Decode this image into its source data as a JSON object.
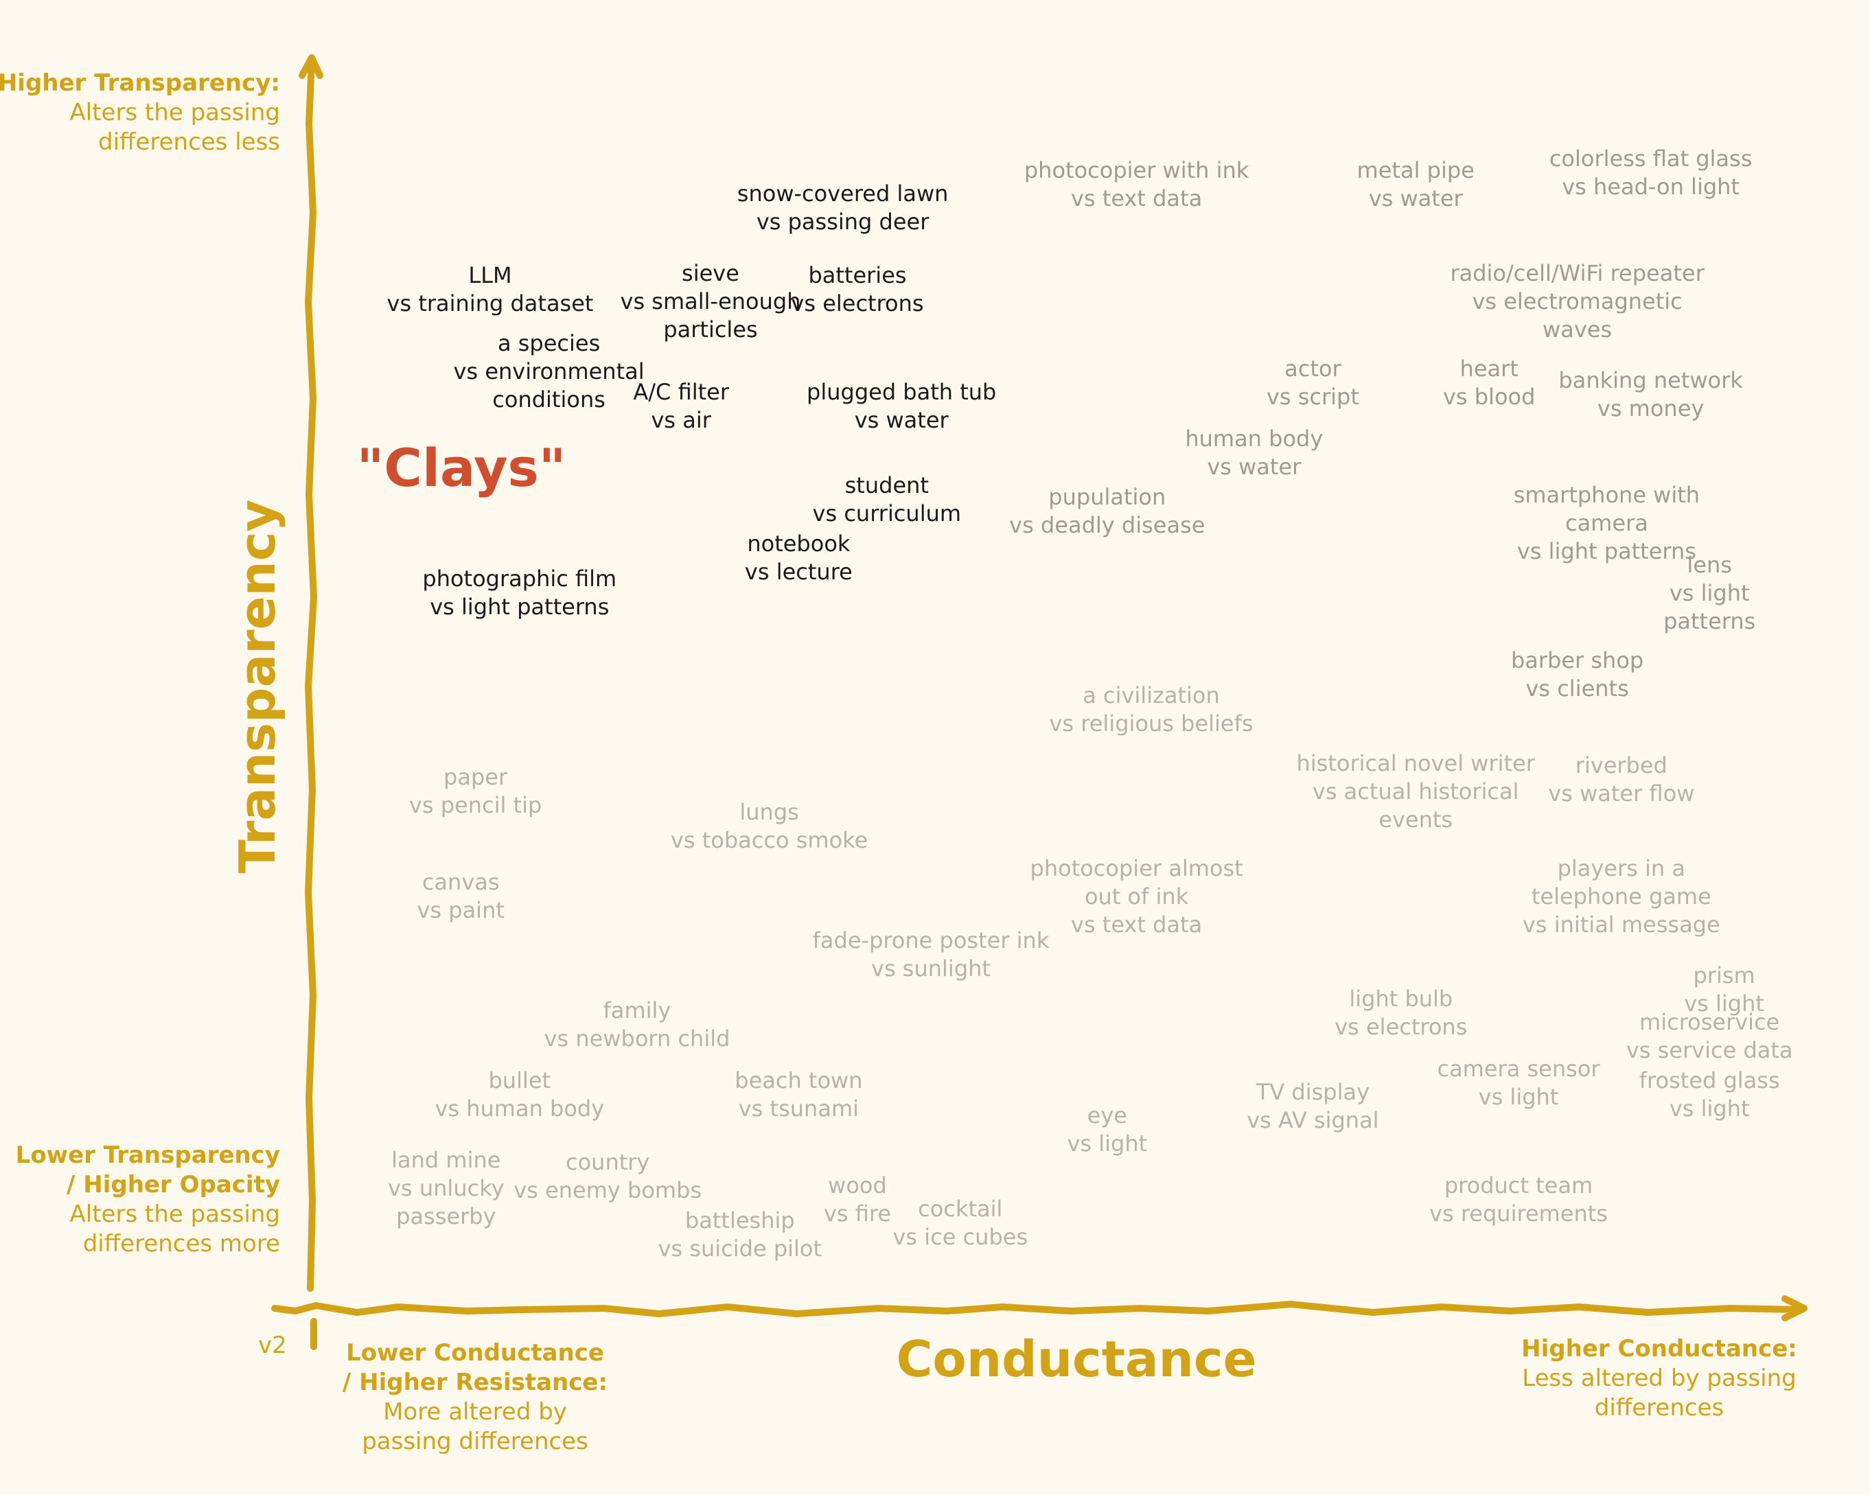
{
  "chart_data": {
    "type": "scatter",
    "title": "",
    "xlabel": "Conductance",
    "ylabel": "Transparency",
    "version_label": "v2",
    "highlight_label": "\"Clays\"",
    "axis_notes": {
      "y_high": {
        "heading": "Higher Transparency:",
        "lines": [
          "Alters the passing",
          "differences less"
        ]
      },
      "y_low": {
        "heading_lines": [
          "Lower Transparency",
          "/ Higher Opacity"
        ],
        "lines": [
          "Alters the passing",
          "differences more"
        ]
      },
      "x_low": {
        "heading_lines": [
          "Lower Conductance",
          "/ Higher Resistance:"
        ],
        "lines": [
          "More altered by",
          "passing differences"
        ]
      },
      "x_high": {
        "heading": "Higher Conductance:",
        "lines": [
          "Less altered by passing",
          "differences"
        ]
      }
    },
    "xlim": [
      0,
      100
    ],
    "ylim": [
      0,
      100
    ],
    "points": [
      {
        "lines": [
          "snow-covered lawn",
          "vs passing deer"
        ],
        "x": 34,
        "y": 91,
        "group": "clay"
      },
      {
        "lines": [
          "LLM",
          "vs training dataset"
        ],
        "x": 10,
        "y": 84,
        "group": "clay"
      },
      {
        "lines": [
          "sieve",
          "vs small-enough",
          "particles"
        ],
        "x": 25,
        "y": 83,
        "group": "clay"
      },
      {
        "lines": [
          "batteries",
          "vs electrons"
        ],
        "x": 35,
        "y": 84,
        "group": "clay"
      },
      {
        "lines": [
          "a species",
          "vs environmental",
          "conditions"
        ],
        "x": 14,
        "y": 77,
        "group": "clay"
      },
      {
        "lines": [
          "A/C filter",
          "vs air"
        ],
        "x": 23,
        "y": 74,
        "group": "clay"
      },
      {
        "lines": [
          "plugged bath tub",
          "vs water"
        ],
        "x": 38,
        "y": 74,
        "group": "clay"
      },
      {
        "lines": [
          "student",
          "vs curriculum"
        ],
        "x": 37,
        "y": 66,
        "group": "clay"
      },
      {
        "lines": [
          "notebook",
          "vs lecture"
        ],
        "x": 31,
        "y": 61,
        "group": "clay"
      },
      {
        "lines": [
          "photographic film",
          "vs light patterns"
        ],
        "x": 12,
        "y": 58,
        "group": "clay"
      },
      {
        "lines": [
          "photocopier with ink",
          "vs text data"
        ],
        "x": 54,
        "y": 93,
        "group": "high"
      },
      {
        "lines": [
          "metal pipe",
          "vs water"
        ],
        "x": 73,
        "y": 93,
        "group": "high"
      },
      {
        "lines": [
          "colorless flat glass",
          "vs head-on light"
        ],
        "x": 89,
        "y": 94,
        "group": "high"
      },
      {
        "lines": [
          "radio/cell/WiFi repeater",
          "vs electromagnetic",
          "waves"
        ],
        "x": 84,
        "y": 83,
        "group": "high"
      },
      {
        "lines": [
          "actor",
          "vs script"
        ],
        "x": 66,
        "y": 76,
        "group": "high"
      },
      {
        "lines": [
          "heart",
          "vs blood"
        ],
        "x": 78,
        "y": 76,
        "group": "high"
      },
      {
        "lines": [
          "banking network",
          "vs money"
        ],
        "x": 89,
        "y": 75,
        "group": "high"
      },
      {
        "lines": [
          "human body",
          "vs water"
        ],
        "x": 62,
        "y": 70,
        "group": "high"
      },
      {
        "lines": [
          "pupulation",
          "vs deadly disease"
        ],
        "x": 52,
        "y": 65,
        "group": "high"
      },
      {
        "lines": [
          "smartphone with",
          "camera",
          "vs light patterns"
        ],
        "x": 86,
        "y": 64,
        "group": "high"
      },
      {
        "lines": [
          "lens",
          "vs light",
          "patterns"
        ],
        "x": 93,
        "y": 58,
        "group": "high"
      },
      {
        "lines": [
          "barber shop",
          "vs clients"
        ],
        "x": 84,
        "y": 51,
        "group": "high"
      },
      {
        "lines": [
          "a civilization",
          "vs religious beliefs"
        ],
        "x": 55,
        "y": 48,
        "group": "low"
      },
      {
        "lines": [
          "riverbed",
          "vs water flow"
        ],
        "x": 87,
        "y": 42,
        "group": "low"
      },
      {
        "lines": [
          "historical novel writer",
          "vs actual historical",
          "events"
        ],
        "x": 73,
        "y": 41,
        "group": "low"
      },
      {
        "lines": [
          "paper",
          "vs pencil tip"
        ],
        "x": 9,
        "y": 41,
        "group": "low"
      },
      {
        "lines": [
          "lungs",
          "vs tobacco smoke"
        ],
        "x": 29,
        "y": 38,
        "group": "low"
      },
      {
        "lines": [
          "canvas",
          "vs paint"
        ],
        "x": 8,
        "y": 32,
        "group": "low"
      },
      {
        "lines": [
          "photocopier almost",
          "out of ink",
          "vs text data"
        ],
        "x": 54,
        "y": 32,
        "group": "low"
      },
      {
        "lines": [
          "players in a",
          "telephone game",
          "vs initial message"
        ],
        "x": 87,
        "y": 32,
        "group": "low"
      },
      {
        "lines": [
          "fade-prone poster ink",
          "vs sunlight"
        ],
        "x": 40,
        "y": 27,
        "group": "low"
      },
      {
        "lines": [
          "prism",
          "vs light"
        ],
        "x": 94,
        "y": 24,
        "group": "low"
      },
      {
        "lines": [
          "light bulb",
          "vs electrons"
        ],
        "x": 72,
        "y": 22,
        "group": "low"
      },
      {
        "lines": [
          "microservice",
          "vs service data"
        ],
        "x": 93,
        "y": 20,
        "group": "low"
      },
      {
        "lines": [
          "family",
          "vs newborn child"
        ],
        "x": 20,
        "y": 21,
        "group": "low"
      },
      {
        "lines": [
          "camera sensor",
          "vs light"
        ],
        "x": 80,
        "y": 16,
        "group": "low"
      },
      {
        "lines": [
          "frosted glass",
          "vs light"
        ],
        "x": 93,
        "y": 15,
        "group": "low"
      },
      {
        "lines": [
          "bullet",
          "vs human body"
        ],
        "x": 12,
        "y": 15,
        "group": "low"
      },
      {
        "lines": [
          "beach town",
          "vs tsunami"
        ],
        "x": 31,
        "y": 15,
        "group": "low"
      },
      {
        "lines": [
          "TV display",
          "vs AV signal"
        ],
        "x": 66,
        "y": 14,
        "group": "low"
      },
      {
        "lines": [
          "eye",
          "vs light"
        ],
        "x": 52,
        "y": 12,
        "group": "low"
      },
      {
        "lines": [
          "land mine",
          "vs unlucky",
          "passerby"
        ],
        "x": 7,
        "y": 7,
        "group": "low"
      },
      {
        "lines": [
          "country",
          "vs enemy bombs"
        ],
        "x": 18,
        "y": 8,
        "group": "low"
      },
      {
        "lines": [
          "wood",
          "vs fire"
        ],
        "x": 35,
        "y": 6,
        "group": "low"
      },
      {
        "lines": [
          "product team",
          "vs requirements"
        ],
        "x": 80,
        "y": 6,
        "group": "low"
      },
      {
        "lines": [
          "cocktail",
          "vs ice cubes"
        ],
        "x": 42,
        "y": 4,
        "group": "low"
      },
      {
        "lines": [
          "battleship",
          "vs suicide pilot"
        ],
        "x": 27,
        "y": 3,
        "group": "low"
      }
    ],
    "colors": {
      "background": "#fdf9ef",
      "axis": "#d4a215",
      "clay_text": "#1a1a1a",
      "high_text": "#9e9a94",
      "low_text": "#b6b2ab",
      "highlight": "#d04e2e"
    }
  }
}
